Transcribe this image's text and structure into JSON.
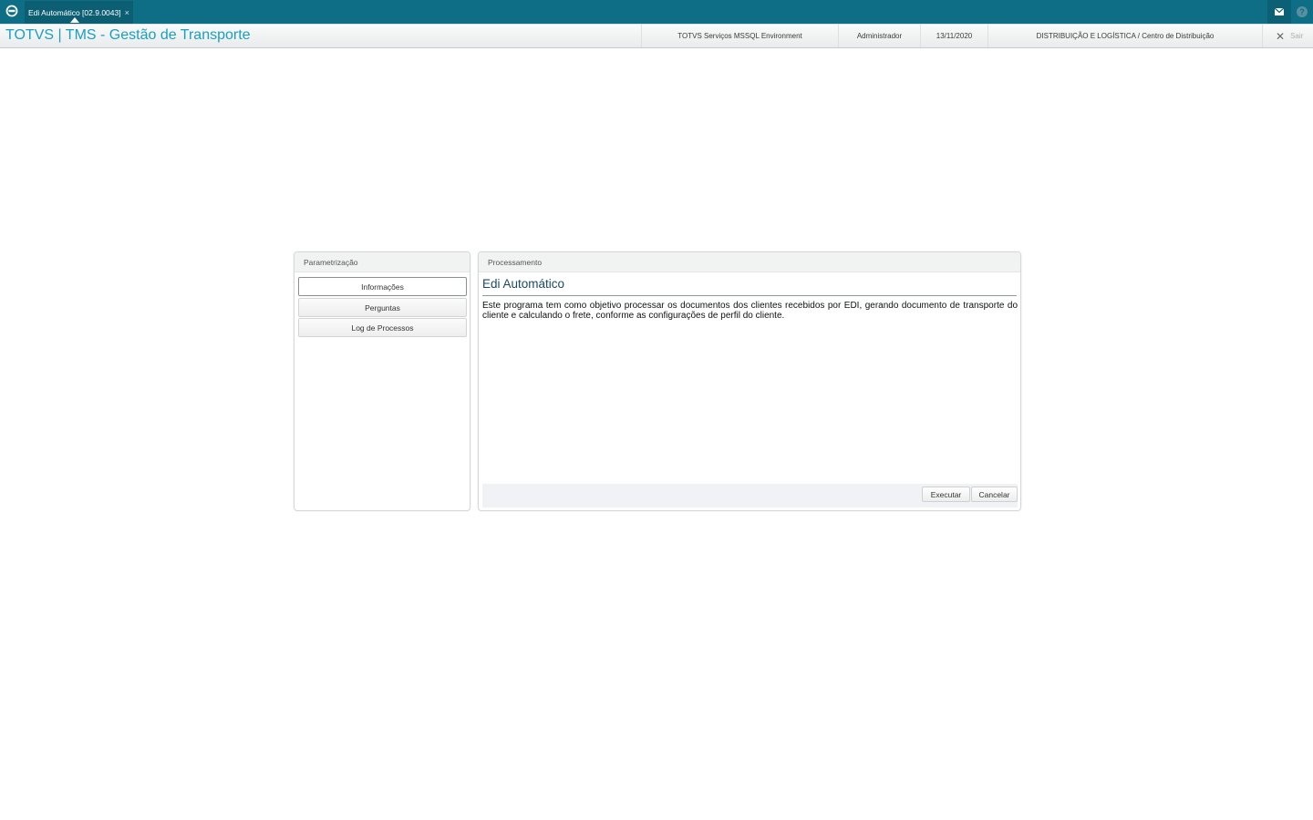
{
  "topbar": {
    "tab_label": "Edi Automático [02.9.0043]",
    "tab_close": "×",
    "icons": {
      "app": "totvs-logo-icon",
      "mail": "mail-icon",
      "help": "help-icon"
    },
    "help_glyph": "?"
  },
  "header": {
    "title": "TOTVS | TMS - Gestão de Transporte",
    "environment": "TOTVS Serviços MSSQL Environment",
    "user": "Administrador",
    "date": "13/11/2020",
    "branch": "DISTRIBUIÇÃO E LOGÍSTICA / Centro de Distribuição",
    "exit_glyph": "✕",
    "exit_label": "Sair"
  },
  "left_panel": {
    "title": "Parametrização",
    "buttons": [
      "Informações",
      "Perguntas",
      "Log de Processos"
    ],
    "active_index": 0
  },
  "right_panel": {
    "title": "Processamento",
    "heading": "Edi Automático",
    "description": "Este programa tem como objetivo processar os documentos dos clientes recebidos por EDI, gerando documento de transporte do cliente e calculando o frete, conforme as configurações de perfil do cliente.",
    "execute_label": "Executar",
    "cancel_label": "Cancelar"
  },
  "colors": {
    "topbar": "#0e6e85",
    "title_accent": "#1a9ec2",
    "heading": "#1b4a66"
  }
}
